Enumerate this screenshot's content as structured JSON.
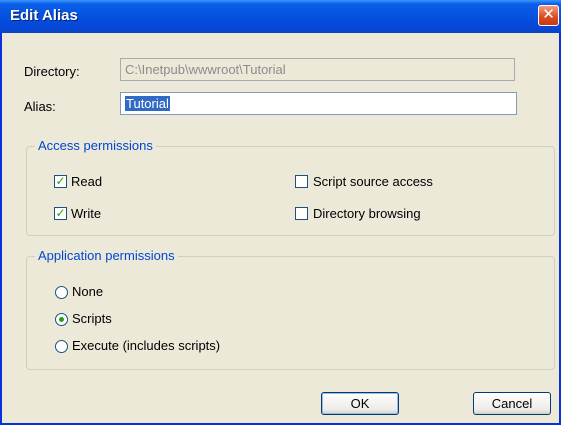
{
  "window": {
    "title": "Edit Alias",
    "close_glyph": "✕"
  },
  "form": {
    "directory_label": "Directory:",
    "directory_value": "C:\\Inetpub\\wwwroot\\Tutorial",
    "alias_label": "Alias:",
    "alias_value": "Tutorial"
  },
  "access_permissions": {
    "title": "Access permissions",
    "options": [
      {
        "label": "Read",
        "checked": true
      },
      {
        "label": "Write",
        "checked": true
      },
      {
        "label": "Script source access",
        "checked": false
      },
      {
        "label": "Directory browsing",
        "checked": false
      }
    ]
  },
  "application_permissions": {
    "title": "Application permissions",
    "options": [
      {
        "label": "None",
        "selected": false
      },
      {
        "label": "Scripts",
        "selected": true
      },
      {
        "label": "Execute (includes scripts)",
        "selected": false
      }
    ]
  },
  "buttons": {
    "ok": "OK",
    "cancel": "Cancel"
  },
  "colors": {
    "titlebar": "#0554e3",
    "accent": "#0046d5",
    "check": "#21a121"
  },
  "icons": {
    "close": "close-icon",
    "checkmark": "checkmark-icon",
    "radio_dot": "radio-dot-icon"
  }
}
